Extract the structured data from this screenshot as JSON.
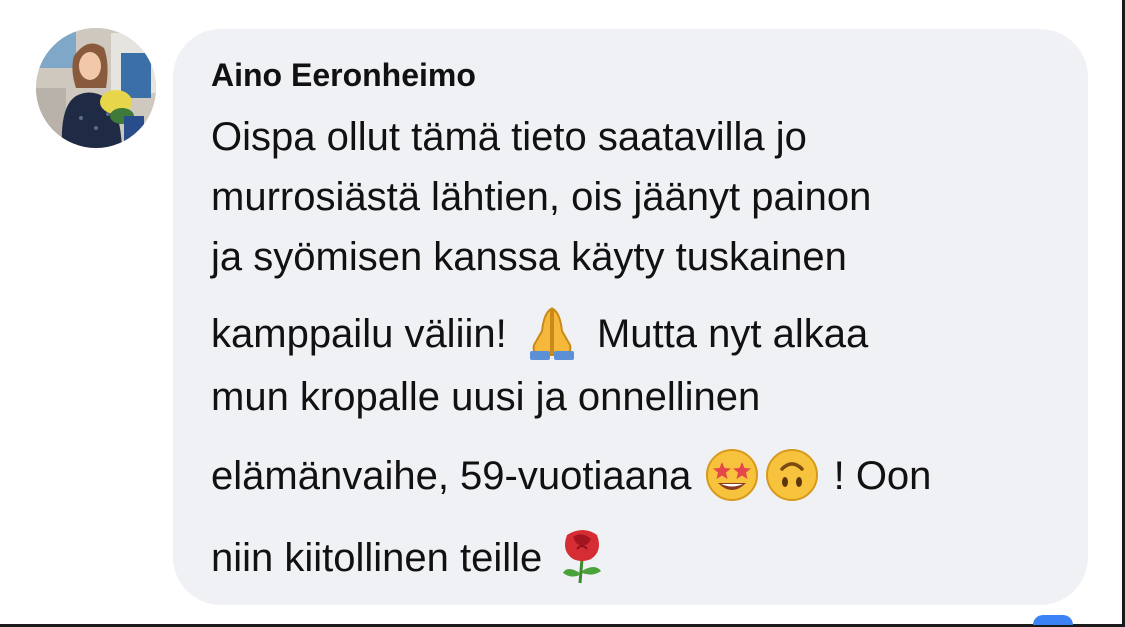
{
  "comment": {
    "author": "Aino Eeronheimo",
    "lines": [
      {
        "text": "Oispa ollut tämä tieto saatavilla jo"
      },
      {
        "text": "murrosiästä lähtien, ois jäänyt painon"
      },
      {
        "text": "ja syömisen kanssa käyty tuskainen"
      },
      {
        "before": "kamppailu väliin!",
        "after": "Mutta nyt alkaa"
      },
      {
        "text": "mun kropalle uusi ja onnellinen"
      },
      {
        "before": "elämänvaihe, 59-vuotiaana",
        "after": "! Oon"
      },
      {
        "before": "niin kiitollinen teille",
        "after": ""
      }
    ]
  },
  "icons": {
    "avatar": "profile-photo",
    "emoji_1": "folded-hands-emoji",
    "emoji_2": "star-struck-emoji",
    "emoji_3": "upside-down-face-emoji",
    "emoji_4": "rose-emoji"
  },
  "colors": {
    "bubble": "#f0f1f5",
    "text": "#111111",
    "background": "#ffffff"
  }
}
